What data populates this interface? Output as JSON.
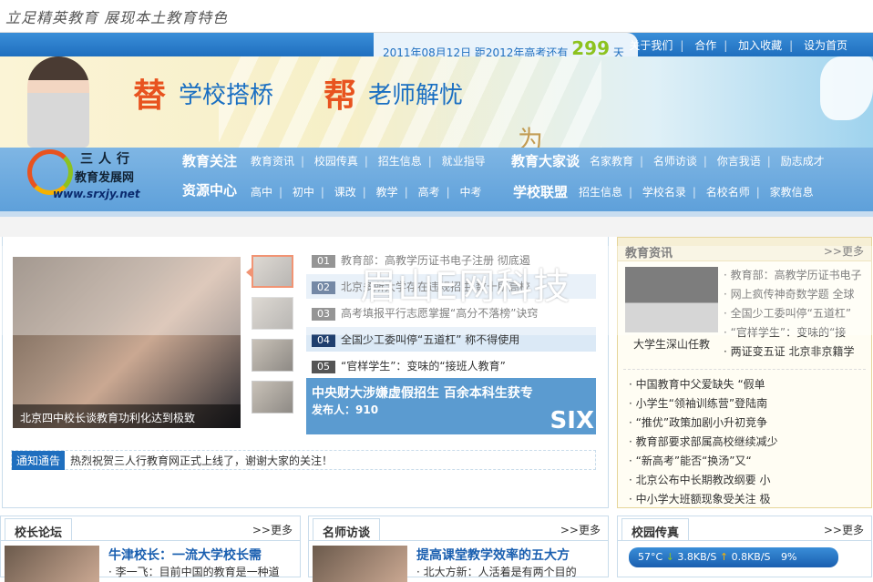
{
  "header": {
    "slogan": "立足精英教育 展现本土教育特色",
    "date_prefix": "2011年08月12日 距2012年高考还有",
    "days": "299",
    "days_unit": "天",
    "links": [
      "关于我们",
      "合作",
      "加入收藏",
      "设为首页"
    ]
  },
  "banner": {
    "c1": "替",
    "t1": "学校搭桥",
    "c2": "帮",
    "t2": "老师解忧",
    "c3": "为"
  },
  "logo": {
    "line1": "三人行",
    "line2": "教育发展网",
    "url": "www.srxjy.net"
  },
  "nav": {
    "edu_focus": {
      "title": "教育关注",
      "links": [
        "教育资讯",
        "校园传真",
        "招生信息",
        "就业指导"
      ]
    },
    "resources": {
      "title": "资源中心",
      "links": [
        "高中",
        "初中",
        "课改",
        "教学",
        "高考",
        "中考"
      ]
    },
    "experts": {
      "title": "教育大家谈",
      "links": [
        "名家教育",
        "名师访谈",
        "你言我语",
        "励志成才"
      ]
    },
    "alliance": {
      "title": "学校联盟",
      "links": [
        "招生信息",
        "学校名录",
        "名校名师",
        "家教信息"
      ]
    }
  },
  "feature": {
    "caption": "北京四中校长谈教育功利化达到极致",
    "news": [
      {
        "num": "01",
        "text": "教育部：高教学历证书电子注册 彻底遏"
      },
      {
        "num": "02",
        "text": "北京多所大学存在违规招生 数十所高校"
      },
      {
        "num": "03",
        "text": "高考填报平行志愿掌握“高分不落榜”诀窍"
      },
      {
        "num": "04",
        "text": "全国少工委叫停“五道杠” 称不得使用"
      },
      {
        "num": "05",
        "text": "“官样学生”：变味的“接班人教育”"
      }
    ],
    "promo_title": "中央财大涉嫌虚假招生 百余本科生获专",
    "promo_poster": "发布人：910",
    "promo_brand": "SIX"
  },
  "notice": {
    "tag": "通知通告",
    "text": "热烈祝贺三人行教育网正式上线了，谢谢大家的关注！"
  },
  "watermark": "眉山E网科技",
  "edu_news": {
    "title": "教育资讯",
    "more": ">>更多",
    "pic_caption": "大学生深山任教",
    "side_items": [
      "教育部：高教学历证书电子",
      "网上疯传神奇数学题 全球",
      "全国少工委叫停“五道杠”",
      "“官样学生”：变味的“接",
      "两证变五证 北京非京籍学"
    ],
    "items": [
      "中国教育中父爱缺失 “假单",
      "小学生“领袖训练营”登陆南",
      "“推优”政策加剧小升初竞争",
      "教育部要求部属高校继续减少",
      "“新高考”能否“换汤”又“",
      "北京公布中长期教改纲要 小",
      "中小学大班额现象受关注 极"
    ]
  },
  "principal_forum": {
    "title": "校长论坛",
    "more": ">>更多",
    "headline": "牛津校长：一流大学校长需",
    "sub": "李一飞：目前中国的教育是一种道"
  },
  "teacher_interview": {
    "title": "名师访谈",
    "more": ">>更多",
    "headline": "提高课堂教学效率的五大方",
    "sub": "北大方新：人活着是有两个目的"
  },
  "campus": {
    "title": "校园传真",
    "more": ">>更多",
    "temp": "57°C",
    "down": "3.8KB/S",
    "up": "0.8KB/S",
    "pct": "9%"
  }
}
